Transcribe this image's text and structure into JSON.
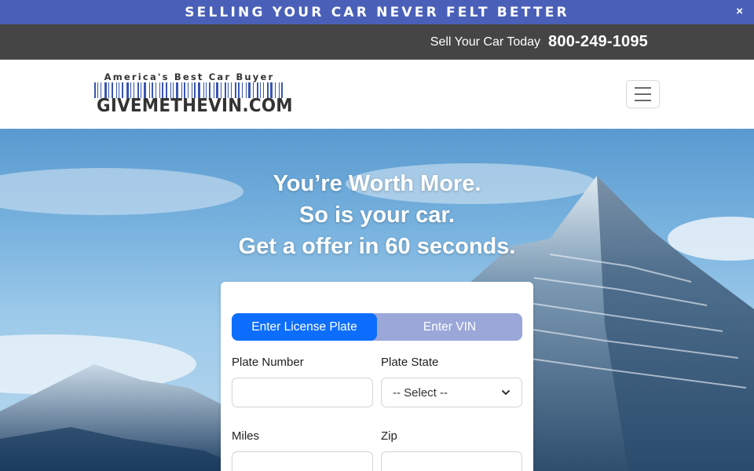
{
  "promo": {
    "text": "SELLING YOUR CAR NEVER FELT BETTER",
    "close_label": "×"
  },
  "phonebar": {
    "label": "Sell Your Car Today",
    "number": "800-249-1095"
  },
  "logo": {
    "tagline": "America's Best Car Buyer",
    "wordmark": "GIVEMETHEVIN.COM"
  },
  "icons": {
    "menu": "hamburger-menu-icon",
    "close": "close-icon",
    "select": "chevron-down-icon"
  },
  "hero": {
    "line1": "You’re Worth More.",
    "line2": "So is your car.",
    "line3": "Get a offer in 60 seconds."
  },
  "form": {
    "tabs": [
      {
        "label": "Enter License Plate",
        "active": true
      },
      {
        "label": "Enter VIN",
        "active": false
      }
    ],
    "plate_number_label": "Plate Number",
    "plate_number_value": "",
    "plate_state_label": "Plate State",
    "plate_state_selected": "-- Select --",
    "miles_label": "Miles",
    "miles_value": "",
    "zip_label": "Zip",
    "zip_value": ""
  },
  "colors": {
    "promo_bg": "#4a60b8",
    "phonebar_bg": "#454545",
    "primary": "#0d6efd",
    "toggle_bg": "#9aa7d8"
  }
}
